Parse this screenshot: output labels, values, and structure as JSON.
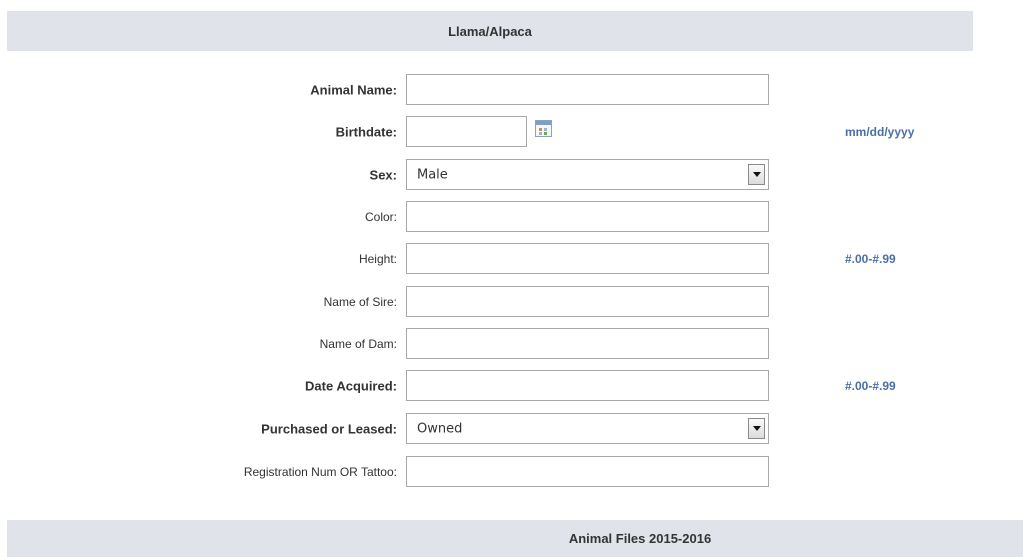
{
  "section": {
    "title": "Llama/Alpaca"
  },
  "fields": {
    "animal_name": {
      "label": "Animal Name:",
      "value": ""
    },
    "birthdate": {
      "label": "Birthdate:",
      "value": "",
      "hint": "mm/dd/yyyy"
    },
    "sex": {
      "label": "Sex:",
      "selected": "Male"
    },
    "color": {
      "label": "Color:",
      "value": ""
    },
    "height": {
      "label": "Height:",
      "value": "",
      "hint": "#.00-#.99"
    },
    "sire": {
      "label": "Name of Sire:",
      "value": ""
    },
    "dam": {
      "label": "Name of Dam:",
      "value": ""
    },
    "date_acquired": {
      "label": "Date Acquired:",
      "value": "",
      "hint": "#.00-#.99"
    },
    "purchased_leased": {
      "label": "Purchased or Leased:",
      "selected": "Owned"
    },
    "registration": {
      "label": "Registration Num OR Tattoo:",
      "value": ""
    }
  },
  "next_section": {
    "title": "Animal Files 2015-2016"
  },
  "icons": {
    "calendar": "calendar-icon",
    "dropdown": "chevron-down-icon"
  },
  "colors": {
    "header_bg": "#e0e4ea",
    "hint_text": "#4a6fa5",
    "input_border": "#a9a9a9"
  }
}
